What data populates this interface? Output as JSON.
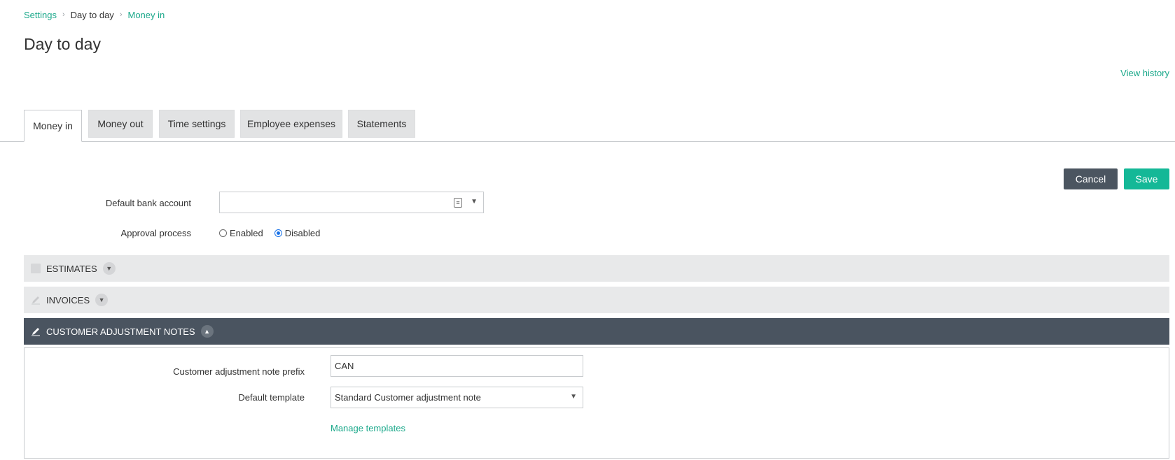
{
  "breadcrumb": {
    "items": [
      "Settings",
      "Day to day",
      "Money in"
    ]
  },
  "page": {
    "title": "Day to day",
    "view_history": "View history"
  },
  "tabs": [
    {
      "label": "Money in",
      "active": true
    },
    {
      "label": "Money out",
      "active": false
    },
    {
      "label": "Time settings",
      "active": false
    },
    {
      "label": "Employee expenses",
      "active": false
    },
    {
      "label": "Statements",
      "active": false
    }
  ],
  "actions": {
    "cancel": "Cancel",
    "save": "Save"
  },
  "form": {
    "default_bank_account_label": "Default bank account",
    "default_bank_account_value": "",
    "approval_process_label": "Approval process",
    "approval_options": {
      "enabled": "Enabled",
      "disabled": "Disabled"
    },
    "approval_selected": "Disabled"
  },
  "sections": {
    "estimates": {
      "title": "ESTIMATES",
      "expanded": false
    },
    "invoices": {
      "title": "INVOICES",
      "expanded": false
    },
    "customer_adjustment_notes": {
      "title": "CUSTOMER ADJUSTMENT NOTES",
      "expanded": true,
      "prefix_label": "Customer adjustment note prefix",
      "prefix_value": "CAN",
      "template_label": "Default template",
      "template_value": "Standard Customer adjustment note",
      "manage_templates": "Manage templates"
    }
  },
  "colors": {
    "accent": "#14b897",
    "link": "#1aa88a",
    "dark_bar": "#4a5460",
    "cancel_button": "#4b5560"
  },
  "icons": {
    "breadcrumb_separator": "chevron-right-icon",
    "lookup": "lookup-icon",
    "dropdown": "caret-down-icon",
    "estimates": "document-icon",
    "invoices": "pencil-icon",
    "expand": "chevron-down-icon",
    "collapse": "chevron-up-icon"
  }
}
